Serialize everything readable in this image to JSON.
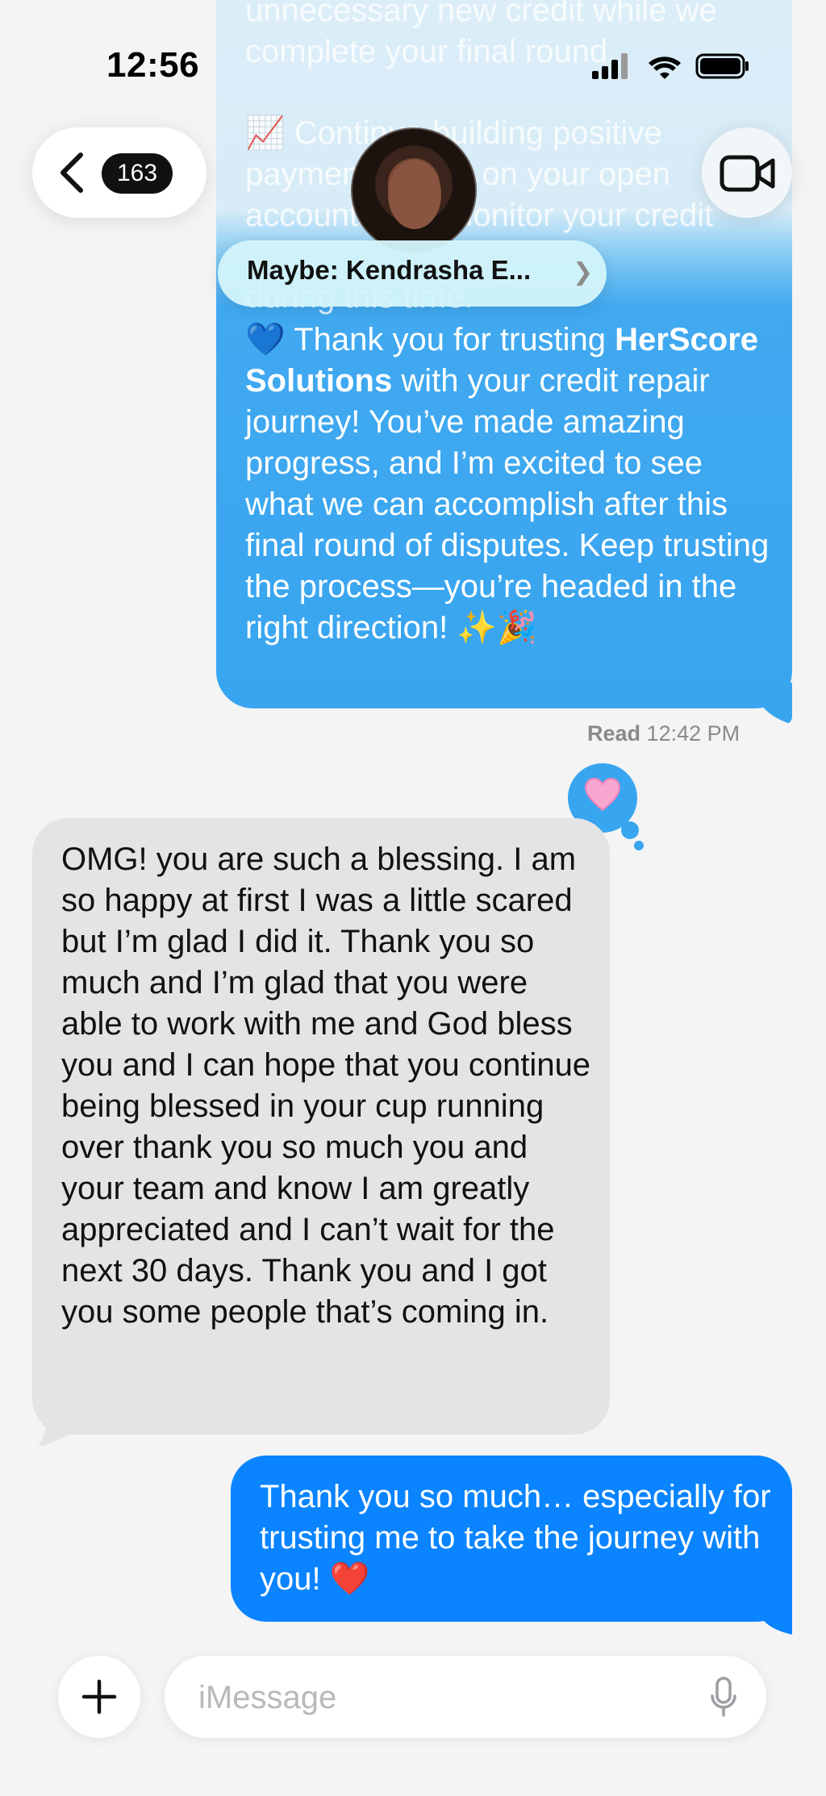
{
  "status_bar": {
    "time": "12:56"
  },
  "header": {
    "back_count": "163",
    "contact_name": "Maybe: Kendrasha E...",
    "contact_chevron": "❯"
  },
  "messages": {
    "top_faded": {
      "line1": "unnecessary new credit while we complete your final round.",
      "line2": "📈 Continue building positive payment history on your open accounts and monitor your credit",
      "line3": "during this time."
    },
    "top_main": {
      "prefix": "💙 Thank you for trusting ",
      "brand": "HerScore Solutions",
      "suffix": " with your credit repair journey! You’ve made amazing progress, and I’m excited to see what we can accomplish after this final round of disputes. Keep trusting the process—you’re headed in the right direction! ✨🎉"
    },
    "read_label": "Read",
    "read_time": "12:42 PM",
    "incoming": "OMG! you are such a blessing. I am so happy at first I was a little scared but I’m glad I did it. Thank you so much and I’m glad that you were able to work with me and God bless you and I can hope that you continue being blessed in your cup running over thank you so much you and your team and know I am greatly appreciated and I can’t wait for the next 30 days. Thank you and I got you some people that’s coming in.",
    "outgoing_last": "Thank you so much… especially for trusting me to take the journey with you! ❤️"
  },
  "input": {
    "placeholder": "iMessage"
  },
  "colors": {
    "outgoing_blue": "#0a84ff",
    "incoming_gray": "#e4e4e6",
    "background": "#f4f4f5"
  },
  "icons": {
    "back": "chevron-left-icon",
    "video": "video-camera-icon",
    "plus": "plus-icon",
    "mic": "microphone-icon",
    "tapback": "pink-heart-icon"
  }
}
